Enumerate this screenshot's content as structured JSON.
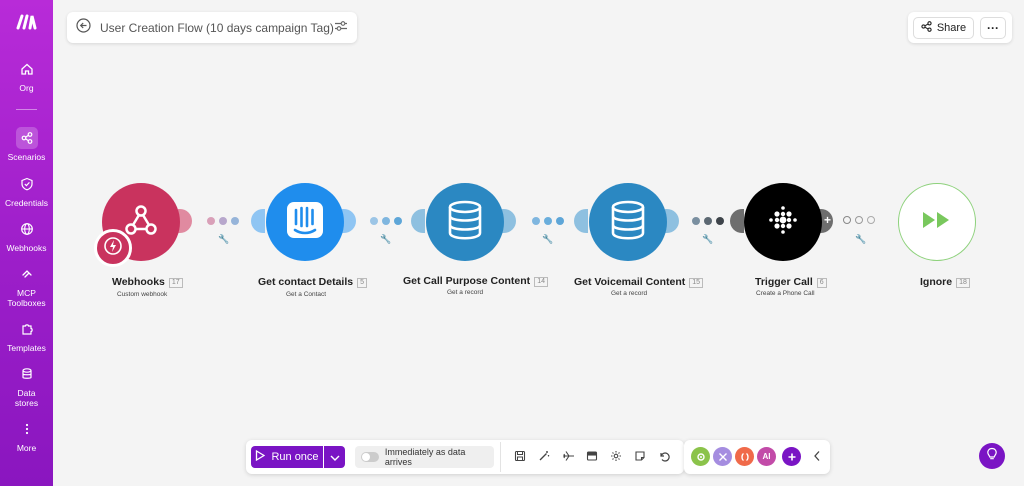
{
  "app": {
    "logo_text": "M",
    "brand_color": "#9c1ec9",
    "accent": "#7a14c4"
  },
  "sidebar": {
    "items": [
      {
        "label": "Org",
        "icon": "home-icon"
      },
      {
        "label": "Scenarios",
        "icon": "share-nodes-icon",
        "active": true
      },
      {
        "label": "Credentials",
        "icon": "shield-check-icon"
      },
      {
        "label": "Webhooks",
        "icon": "globe-icon"
      },
      {
        "label": "MCP\nToolboxes",
        "icon": "mcp-icon"
      },
      {
        "label": "Templates",
        "icon": "puzzle-icon"
      },
      {
        "label": "Data\nstores",
        "icon": "database-icon"
      },
      {
        "label": "More",
        "icon": "more-vertical-icon"
      }
    ]
  },
  "header": {
    "title": "User Creation Flow (10 days campaign Tag)",
    "share_label": "Share",
    "more_label": "···"
  },
  "flow": {
    "modules": [
      {
        "name": "Webhooks",
        "id": "17",
        "subtitle": "Custom webhook",
        "color": "#c9335e",
        "icon": "webhook-icon"
      },
      {
        "name": "Get contact Details",
        "id": "5",
        "subtitle": "Get a Contact",
        "color": "#1f8ded",
        "icon": "intercom-icon"
      },
      {
        "name": "Get Call Purpose Content",
        "id": "14",
        "subtitle": "Get a record",
        "color": "#2b88c2",
        "icon": "database-icon"
      },
      {
        "name": "Get Voicemail Content",
        "id": "15",
        "subtitle": "Get a record",
        "color": "#2b88c2",
        "icon": "database-icon"
      },
      {
        "name": "Trigger Call",
        "id": "6",
        "subtitle": "Create a Phone Call",
        "color": "#000000",
        "icon": "dots-grid-icon"
      },
      {
        "name": "Ignore",
        "id": "18",
        "subtitle": "",
        "color": "#ffffff",
        "icon": "fast-forward-icon"
      }
    ]
  },
  "toolbar": {
    "run_label": "Run once",
    "schedule_label": "Immediately as data arrives",
    "ai_label": "AI"
  }
}
